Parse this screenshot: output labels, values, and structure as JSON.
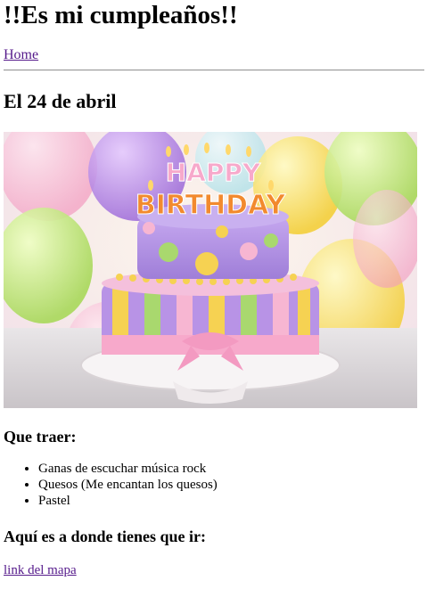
{
  "page": {
    "title": "!!Es mi cumpleaños!!",
    "nav_home": "Home",
    "date_heading": "El 24 de abril",
    "image_alt": "Birthday cake with candles",
    "bring_heading": "Que traer:",
    "items": [
      "Ganas de escuchar música rock",
      "Quesos (Me encantan los quesos)",
      "Pastel"
    ],
    "where_heading": "Aquí es a donde tienes que ir:",
    "map_link": "link del mapa"
  },
  "image": {
    "topper_line1": "HAPPY",
    "topper_line2": "BIRTHDAY"
  },
  "colors": {
    "visited_link": "#551a8b",
    "cake_purple": "#b89be6",
    "cake_pink": "#f7b6d2",
    "cake_yellow": "#f6d252",
    "cake_green": "#a9d86e"
  }
}
